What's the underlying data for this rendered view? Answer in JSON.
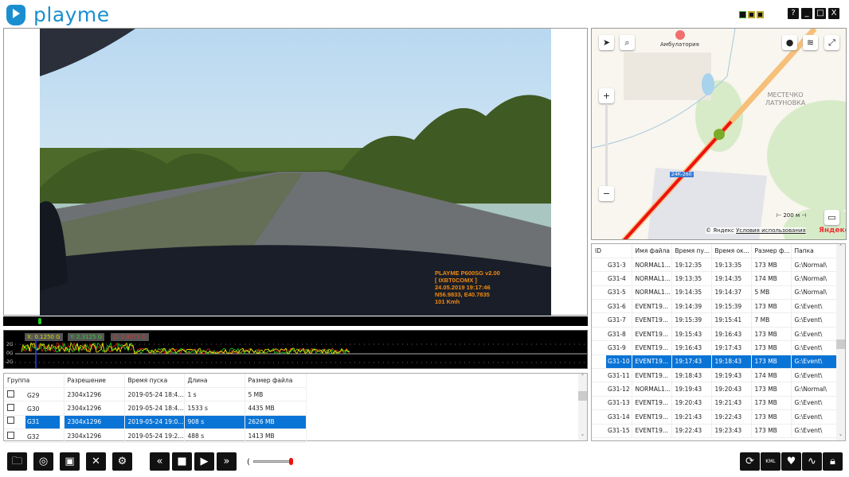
{
  "app": {
    "name": "playme",
    "window_buttons": [
      "?",
      "_",
      "□",
      "X"
    ]
  },
  "video": {
    "osd": [
      "PLAYME P600SG v2.00",
      "[ IXBT0COMX ]",
      "24.05.2019 19:17:46",
      "N56.9833, E40.7835",
      "101 Kmh"
    ],
    "progress_percent": 0
  },
  "accel": {
    "x_label": "X: 0.1250 G",
    "y_label": "Y: 2.3125 G",
    "z_label": "Z: 2.9375 G",
    "ticks": [
      "2G",
      "0G",
      "-2G"
    ],
    "colors": {
      "x": "#f0f000",
      "y": "#20d020",
      "z": "#e02020"
    }
  },
  "groups": {
    "headers": [
      "Группа",
      "Разрешение",
      "Время пуска",
      "Длина",
      "Размер файла"
    ],
    "rows": [
      {
        "group": "G29",
        "res": "2304x1296",
        "start": "2019-05-24 18:4...",
        "len": "1 s",
        "size": "5 MB"
      },
      {
        "group": "G30",
        "res": "2304x1296",
        "start": "2019-05-24 18:4...",
        "len": "1533 s",
        "size": "4435 MB"
      },
      {
        "group": "G31",
        "res": "2304x1296",
        "start": "2019-05-24 19:0...",
        "len": "908 s",
        "size": "2626 MB",
        "selected": true
      },
      {
        "group": "G32",
        "res": "2304x1296",
        "start": "2019-05-24 19:2...",
        "len": "488 s",
        "size": "1413 MB"
      }
    ]
  },
  "map": {
    "poi": "Амбулатория",
    "place": [
      "МЕСТЕЧКО",
      "ЛАТУНОВКА"
    ],
    "road": "24К-260",
    "scale": "200 м",
    "copyright": "© Яндекс",
    "terms": "Условия использования",
    "brand": "Яндекс"
  },
  "files": {
    "headers": [
      "ID",
      "Имя файла",
      "Время пу...",
      "Время ок...",
      "Размер ф...",
      "Папка"
    ],
    "rows": [
      [
        "G31-3",
        "NORMAL1...",
        "19:12:35",
        "19:13:35",
        "173 MB",
        "G:\\Normal\\"
      ],
      [
        "G31-4",
        "NORMAL1...",
        "19:13:35",
        "19:14:35",
        "174 MB",
        "G:\\Normal\\"
      ],
      [
        "G31-5",
        "NORMAL1...",
        "19:14:35",
        "19:14:37",
        "5 MB",
        "G:\\Normal\\"
      ],
      [
        "G31-6",
        "EVENT19...",
        "19:14:39",
        "19:15:39",
        "173 MB",
        "G:\\Event\\"
      ],
      [
        "G31-7",
        "EVENT19...",
        "19:15:39",
        "19:15:41",
        "7 MB",
        "G:\\Event\\"
      ],
      [
        "G31-8",
        "EVENT19...",
        "19:15:43",
        "19:16:43",
        "173 MB",
        "G:\\Event\\"
      ],
      [
        "G31-9",
        "EVENT19...",
        "19:16:43",
        "19:17:43",
        "173 MB",
        "G:\\Event\\"
      ],
      [
        "G31-10",
        "EVENT19...",
        "19:17:43",
        "19:18:43",
        "173 MB",
        "G:\\Event\\"
      ],
      [
        "G31-11",
        "EVENT19...",
        "19:18:43",
        "19:19:43",
        "174 MB",
        "G:\\Event\\"
      ],
      [
        "G31-12",
        "NORMAL1...",
        "19:19:43",
        "19:20:43",
        "173 MB",
        "G:\\Normal\\"
      ],
      [
        "G31-13",
        "EVENT19...",
        "19:20:43",
        "19:21:43",
        "173 MB",
        "G:\\Event\\"
      ],
      [
        "G31-14",
        "EVENT19...",
        "19:21:43",
        "19:22:43",
        "173 MB",
        "G:\\Event\\"
      ],
      [
        "G31-15",
        "EVENT19...",
        "19:22:43",
        "19:23:43",
        "173 MB",
        "G:\\Event\\"
      ]
    ],
    "selected_index": 7
  },
  "toolbar": {
    "left": [
      "folder-open",
      "camera",
      "save",
      "delete-file",
      "settings"
    ],
    "playback": [
      "«",
      "■",
      "▶",
      "»"
    ],
    "volume_percent": 100,
    "right": [
      "sync",
      "kml",
      "map-pin",
      "audio",
      "lock"
    ]
  },
  "accent": "#0a74d6"
}
